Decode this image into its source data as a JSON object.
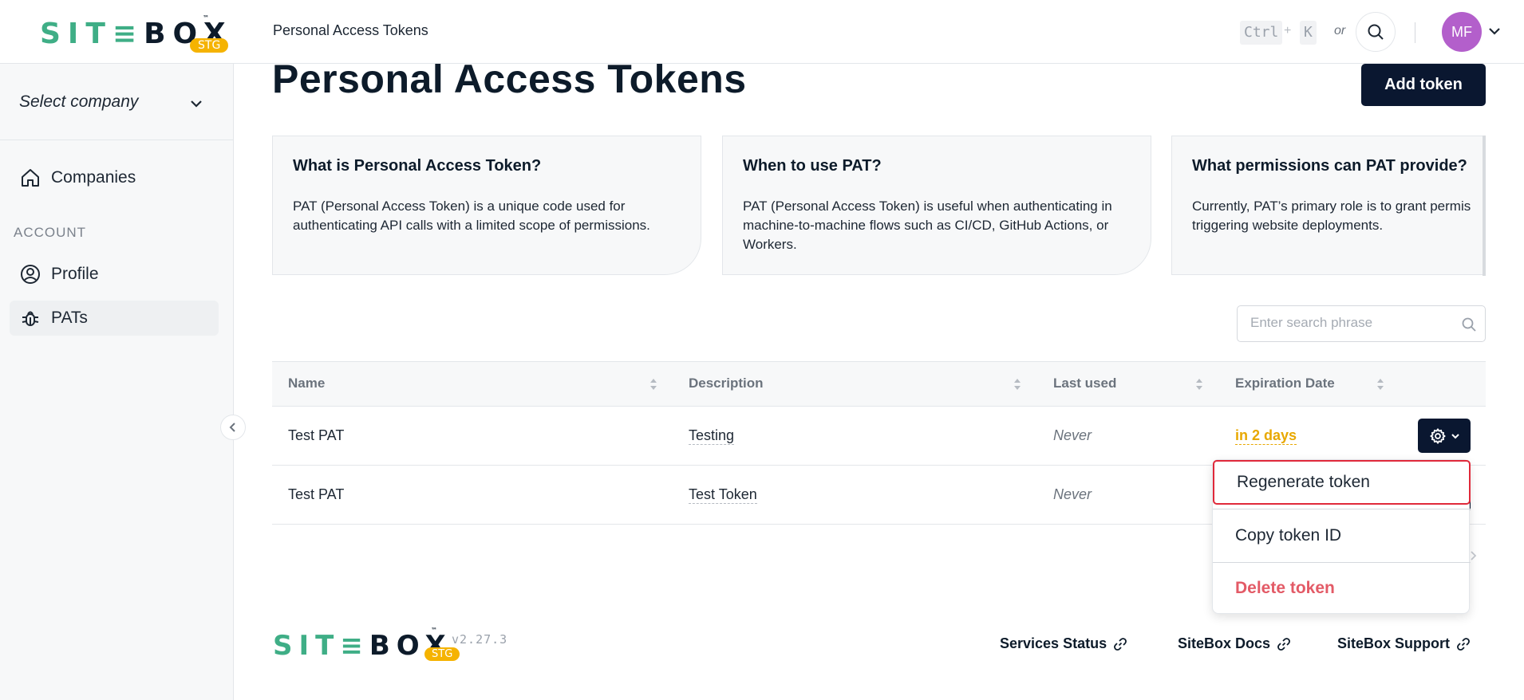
{
  "header": {
    "logo": {
      "left": "SIT",
      "right": "BOX",
      "tm": "™",
      "badge": "STG"
    },
    "title": "Personal Access Tokens",
    "shortcut": {
      "ctrl": "Ctrl",
      "plus": "+",
      "k": "K",
      "or": "or"
    },
    "avatar_initials": "MF"
  },
  "sidebar": {
    "company_select": "Select company",
    "section_label": "ACCOUNT",
    "items": [
      {
        "label": "Companies",
        "icon": "home-icon"
      },
      {
        "label": "Profile",
        "icon": "user-circle-icon"
      },
      {
        "label": "PATs",
        "icon": "bug-icon",
        "active": true
      }
    ]
  },
  "main": {
    "page_title": "Personal Access Tokens",
    "add_button": "Add token",
    "cards": [
      {
        "title": "What is Personal Access Token?",
        "body": "PAT (Personal Access Token) is a unique code used for authenticating API calls with a limited scope of permissions."
      },
      {
        "title": "When to use PAT?",
        "body": "PAT (Personal Access Token) is useful when authenticating in machine-to-machine flows such as CI/CD, GitHub Actions, or Workers."
      },
      {
        "title": "What permissions can PAT provide?",
        "body": "Currently, PAT’s primary role is to grant permis triggering website deployments."
      }
    ],
    "search_placeholder": "Enter search phrase",
    "table": {
      "columns": [
        "Name",
        "Description",
        "Last used",
        "Expiration Date"
      ],
      "rows": [
        {
          "name": "Test PAT",
          "description": "Testing",
          "last_used": "Never",
          "expiration": "in 2 days"
        },
        {
          "name": "Test PAT",
          "description": "Test Token",
          "last_used": "Never",
          "expiration": ""
        }
      ]
    },
    "dropdown": {
      "items": [
        {
          "label": "Regenerate token"
        },
        {
          "label": "Copy token ID"
        },
        {
          "label": "Delete token"
        }
      ]
    }
  },
  "footer": {
    "version": "v2.27.3",
    "links": [
      "Services Status",
      "SiteBox Docs",
      "SiteBox Support"
    ]
  },
  "colors": {
    "brand_green": "#3fae86",
    "navy": "#0a1730",
    "badge": "#f5b301",
    "warning": "#e8a800",
    "danger": "#e35a66",
    "focus_ring": "#e0293a"
  }
}
